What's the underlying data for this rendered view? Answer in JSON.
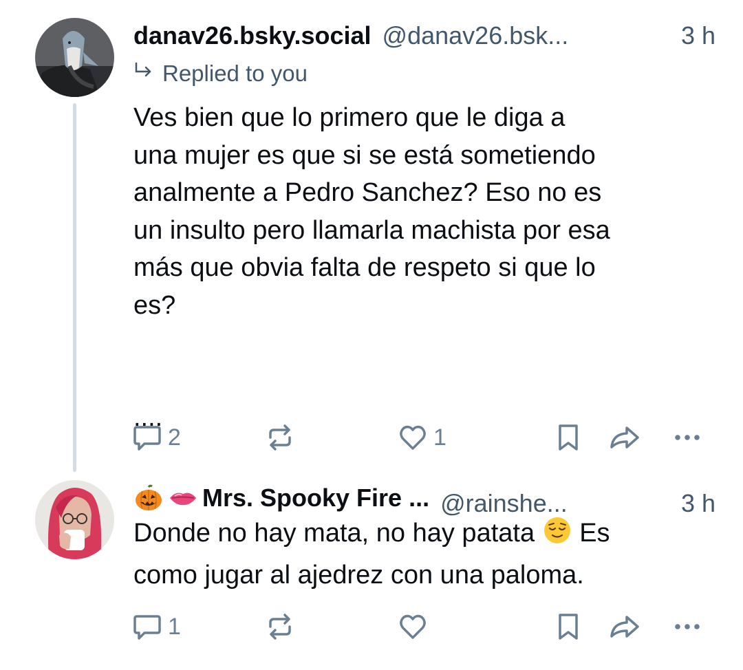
{
  "posts": [
    {
      "display_name": "danav26.bsky.social",
      "handle": "@danav26.bsk...",
      "time": "3 h",
      "replied_label": "Replied to you",
      "text": "Ves bien que lo primero que le diga a\nuna mujer es que si se está sometiendo\nanalmente a Pedro Sanchez? Eso no es\nun insulto pero llamarla machista por esa\nmás que obvia falta de respeto si que lo\nes?\n\n\n....",
      "reply_count": "2",
      "like_count": "1"
    },
    {
      "display_name": "Mrs. Spooky Fire ...",
      "handle": "@rainshe...",
      "time": "3 h",
      "text_line1_a": "Donde no hay mata, no hay patata ",
      "text_line1_b": " Es",
      "text_line2": "como jugar al ajedrez con una paloma.",
      "reply_count": "1",
      "like_count": ""
    }
  ],
  "icons": {
    "reply": "speech-bubble-icon",
    "repost": "repost-arrows-icon",
    "like": "heart-icon",
    "bookmark": "bookmark-icon",
    "share": "share-arrow-icon",
    "more": "more-dots-icon",
    "replied": "reply-arrow-icon"
  },
  "colors": {
    "text": "#0b0f14",
    "muted": "#42576c",
    "icon": "#6b7f93",
    "thread_line": "#d4dbe2"
  }
}
